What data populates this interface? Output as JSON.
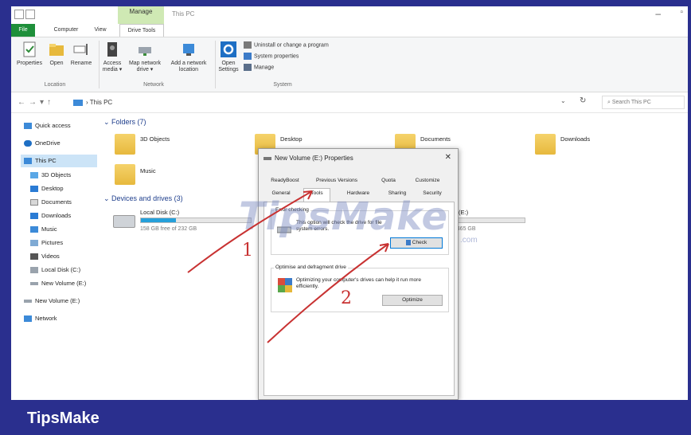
{
  "titlebar": {
    "context_tab": "Manage",
    "window_title": "This PC",
    "minimize": "–",
    "maximize": "▫"
  },
  "ribbon_tabs": {
    "file": "File",
    "computer": "Computer",
    "view": "View",
    "drive_tools": "Drive Tools"
  },
  "ribbon": {
    "location": {
      "label": "Location",
      "buttons": [
        "Properties",
        "Open",
        "Rename"
      ]
    },
    "network": {
      "label": "Network",
      "buttons": [
        "Access media ▾",
        "Map network drive ▾",
        "Add a network location"
      ]
    },
    "system": {
      "label": "System",
      "open_settings": "Open Settings",
      "items": [
        "Uninstall or change a program",
        "System properties",
        "Manage"
      ]
    }
  },
  "address": {
    "back": "←",
    "forward": "→",
    "recent": "▾",
    "up": "↑",
    "path": "› This PC",
    "dropdown": "⌄",
    "refresh": "↻",
    "search_placeholder": "Search This PC",
    "search_icon": "⌕"
  },
  "sidebar": {
    "items": [
      "Quick access",
      "OneDrive",
      "This PC",
      "3D Objects",
      "Desktop",
      "Documents",
      "Downloads",
      "Music",
      "Pictures",
      "Videos",
      "Local Disk (C:)",
      "New Volume (E:)",
      "New Volume (E:)",
      "Network"
    ]
  },
  "content": {
    "folders_header": "Folders (7)",
    "folders": [
      "3D Objects",
      "Desktop",
      "Documents",
      "Downloads",
      "Music"
    ],
    "drives_header": "Devices and drives (3)",
    "drive_c": {
      "name": "Local Disk (C:)",
      "free": "158 GB free of 232 GB",
      "used_fraction": 0.32
    },
    "drive_e": {
      "name": "(E:)",
      "free": "of 465 GB",
      "used_fraction": 0.1
    }
  },
  "dialog": {
    "title": "New Volume (E:) Properties",
    "close": "✕",
    "tabs_row1": [
      "ReadyBoost",
      "Previous Versions",
      "Quota",
      "Customize"
    ],
    "tabs_row2": [
      "General",
      "Tools",
      "Hardware",
      "Sharing",
      "Security"
    ],
    "error_checking": {
      "label": "Error checking",
      "text": "This option will check the drive for file system errors.",
      "button": "Check"
    },
    "optimize": {
      "label": "Optimise and defragment drive",
      "text": "Optimizing your computer's drives can help it run more efficiently.",
      "button": "Optimize"
    }
  },
  "watermark": {
    "text": "TipsMake",
    "suffix": ".com"
  },
  "annotations": {
    "step1": "1",
    "step2": "2"
  },
  "brand": "TipsMake",
  "colors": {
    "frame": "#2a2f8e",
    "file_tab": "#1e8f3a",
    "manage_tab": "#cfe9b4",
    "arrow": "#c83232",
    "selection": "#cce4f7"
  }
}
